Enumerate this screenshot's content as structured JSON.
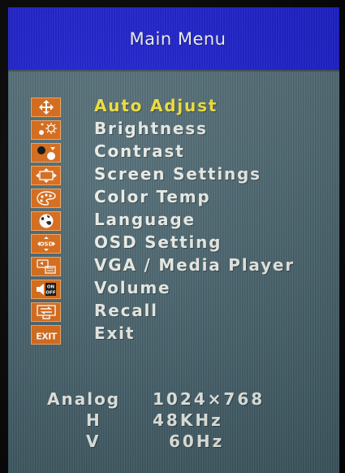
{
  "title": "Main Menu",
  "menu": [
    {
      "label": "Auto  Adjust",
      "icon": "move-arrows-icon",
      "selected": true
    },
    {
      "label": "Brightness",
      "icon": "sun-icon",
      "selected": false
    },
    {
      "label": "Contrast",
      "icon": "contrast-icon",
      "selected": false
    },
    {
      "label": "Screen  Settings",
      "icon": "screen-position-icon",
      "selected": false
    },
    {
      "label": "Color  Temp",
      "icon": "palette-icon",
      "selected": false
    },
    {
      "label": "Language",
      "icon": "globe-icon",
      "selected": false
    },
    {
      "label": "OSD  Setting",
      "icon": "osd-icon",
      "selected": false
    },
    {
      "label": "VGA / Media  Player",
      "icon": "media-input-icon",
      "selected": false
    },
    {
      "label": "Volume",
      "icon": "speaker-icon",
      "selected": false
    },
    {
      "label": "Recall",
      "icon": "recall-icon",
      "selected": false
    },
    {
      "label": "Exit",
      "icon": "exit-icon",
      "selected": false
    }
  ],
  "info": {
    "source": "Analog",
    "resolution": "1024×768",
    "h_label": "H",
    "h_value": "48KHz",
    "v_label": "V",
    "v_value": "60Hz"
  },
  "icon_texts": {
    "on": "ON",
    "off": "OFF",
    "exit": "EXIT",
    "osd": "OSD"
  },
  "colors": {
    "title_bar": "#1f22d6",
    "icon_background": "#d86a17",
    "selected_text": "#f1e23a",
    "normal_text": "#e9ece6"
  }
}
